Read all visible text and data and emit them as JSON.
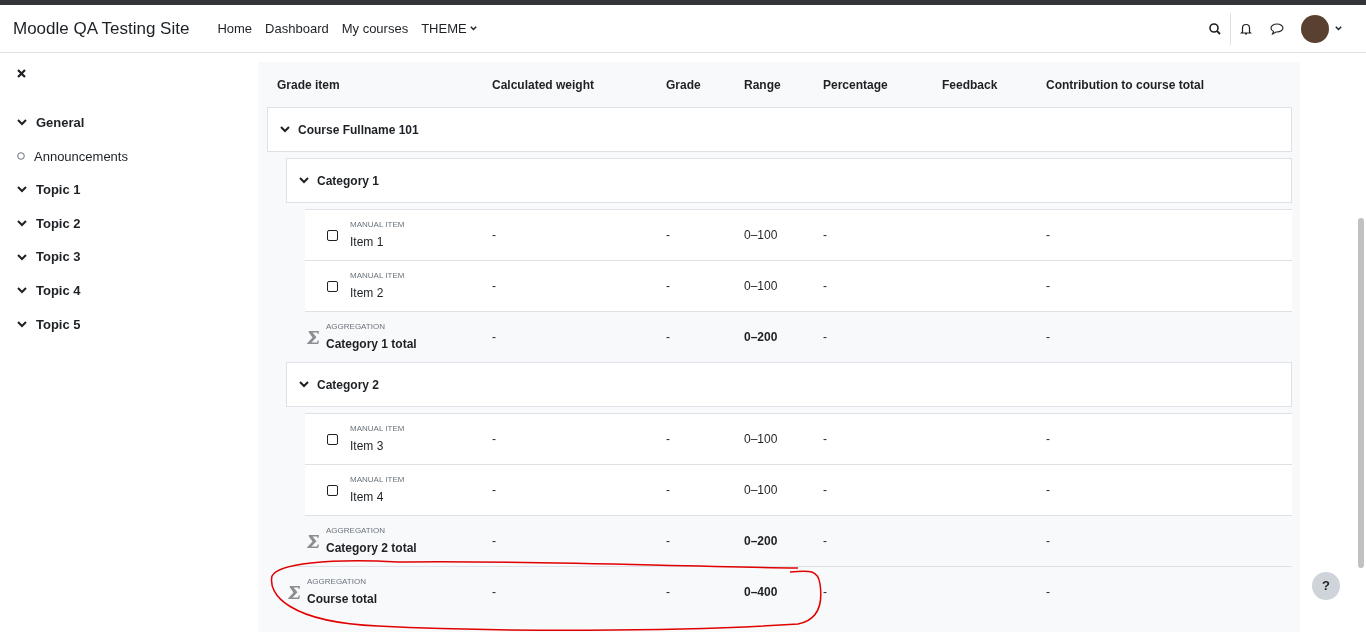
{
  "navbar": {
    "site_name": "Moodle QA Testing Site",
    "links": [
      {
        "label": "Home",
        "kind": "link"
      },
      {
        "label": "Dashboard",
        "kind": "link"
      },
      {
        "label": "My courses",
        "kind": "link"
      },
      {
        "label": "THEME",
        "kind": "dropdown"
      }
    ]
  },
  "sidebar": {
    "items": [
      {
        "label": "General",
        "kind": "section",
        "expanded": true
      },
      {
        "label": "Announcements",
        "kind": "activity"
      },
      {
        "label": "Topic 1",
        "kind": "section",
        "expanded": true
      },
      {
        "label": "Topic 2",
        "kind": "section",
        "expanded": true
      },
      {
        "label": "Topic 3",
        "kind": "section",
        "expanded": true
      },
      {
        "label": "Topic 4",
        "kind": "section",
        "expanded": true
      },
      {
        "label": "Topic 5",
        "kind": "section",
        "expanded": true
      }
    ]
  },
  "table": {
    "columns": [
      "Grade item",
      "Calculated weight",
      "Grade",
      "Range",
      "Percentage",
      "Feedback",
      "Contribution to course total"
    ],
    "rows": [
      {
        "kind": "category",
        "name": "Course Fullname 101",
        "expanded": true,
        "children": [
          {
            "kind": "category",
            "name": "Category 1",
            "expanded": true,
            "children": [
              {
                "kind": "item",
                "type_label": "MANUAL ITEM",
                "name": "Item 1",
                "checked": false,
                "weight": "-",
                "grade": "-",
                "range": "0–100",
                "percentage": "-",
                "contribution": "-"
              },
              {
                "kind": "item",
                "type_label": "MANUAL ITEM",
                "name": "Item 2",
                "checked": false,
                "weight": "-",
                "grade": "-",
                "range": "0–100",
                "percentage": "-",
                "contribution": "-"
              },
              {
                "kind": "aggregation",
                "type_label": "AGGREGATION",
                "name": "Category 1 total",
                "weight": "-",
                "grade": "-",
                "range": "0–200",
                "percentage": "-",
                "contribution": "-"
              }
            ]
          },
          {
            "kind": "category",
            "name": "Category 2",
            "expanded": true,
            "children": [
              {
                "kind": "item",
                "type_label": "MANUAL ITEM",
                "name": "Item 3",
                "checked": false,
                "weight": "-",
                "grade": "-",
                "range": "0–100",
                "percentage": "-",
                "contribution": "-"
              },
              {
                "kind": "item",
                "type_label": "MANUAL ITEM",
                "name": "Item 4",
                "checked": false,
                "weight": "-",
                "grade": "-",
                "range": "0–100",
                "percentage": "-",
                "contribution": "-"
              },
              {
                "kind": "aggregation",
                "type_label": "AGGREGATION",
                "name": "Category 2 total",
                "weight": "-",
                "grade": "-",
                "range": "0–200",
                "percentage": "-",
                "contribution": "-"
              }
            ]
          },
          {
            "kind": "aggregation",
            "type_label": "AGGREGATION",
            "name": "Course total",
            "weight": "-",
            "grade": "-",
            "range": "0–400",
            "percentage": "-",
            "contribution": "-",
            "circled": true
          }
        ]
      }
    ]
  },
  "help_button": "?"
}
